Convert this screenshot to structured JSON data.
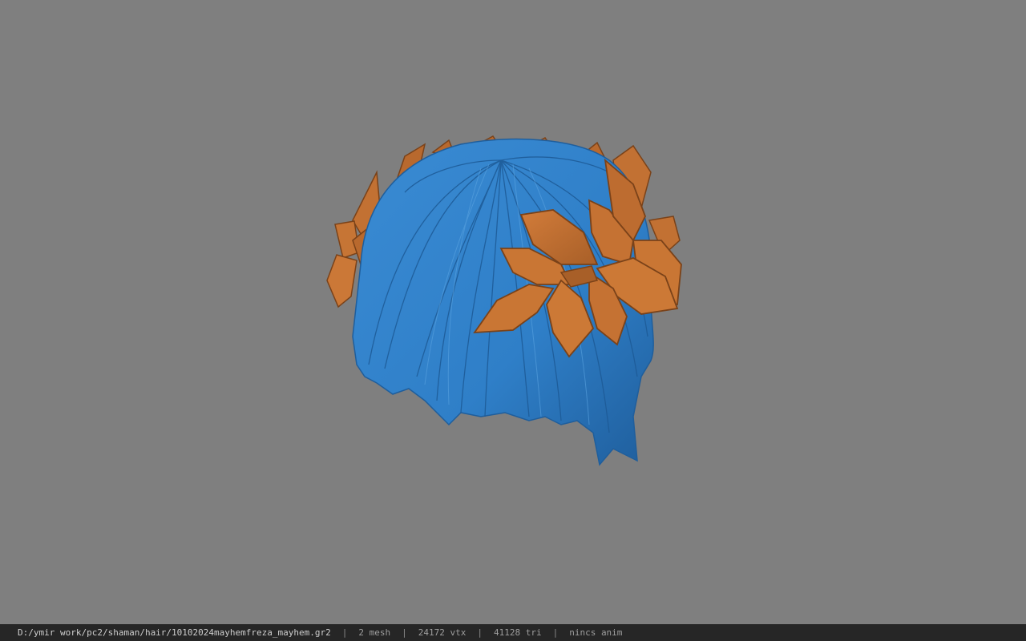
{
  "viewport": {
    "background_color": "#7f7f7f",
    "model": {
      "name": "hair-mesh-with-leaf-crown",
      "hair_color": "#2f7fc8",
      "hair_dark_color": "#1f5e9c",
      "leaf_color": "#c57233",
      "leaf_dark_color": "#8a4a1f"
    }
  },
  "status_bar": {
    "file_path": "D:/ymir work/pc2/shaman/hair/10102024mayhemfreza_mayhem.gr2",
    "separator": "|",
    "mesh_count": "2 mesh",
    "vertex_count": "24172 vtx",
    "triangle_count": "41128 tri",
    "anim_status": "nincs anim",
    "background_color": "#262626"
  }
}
